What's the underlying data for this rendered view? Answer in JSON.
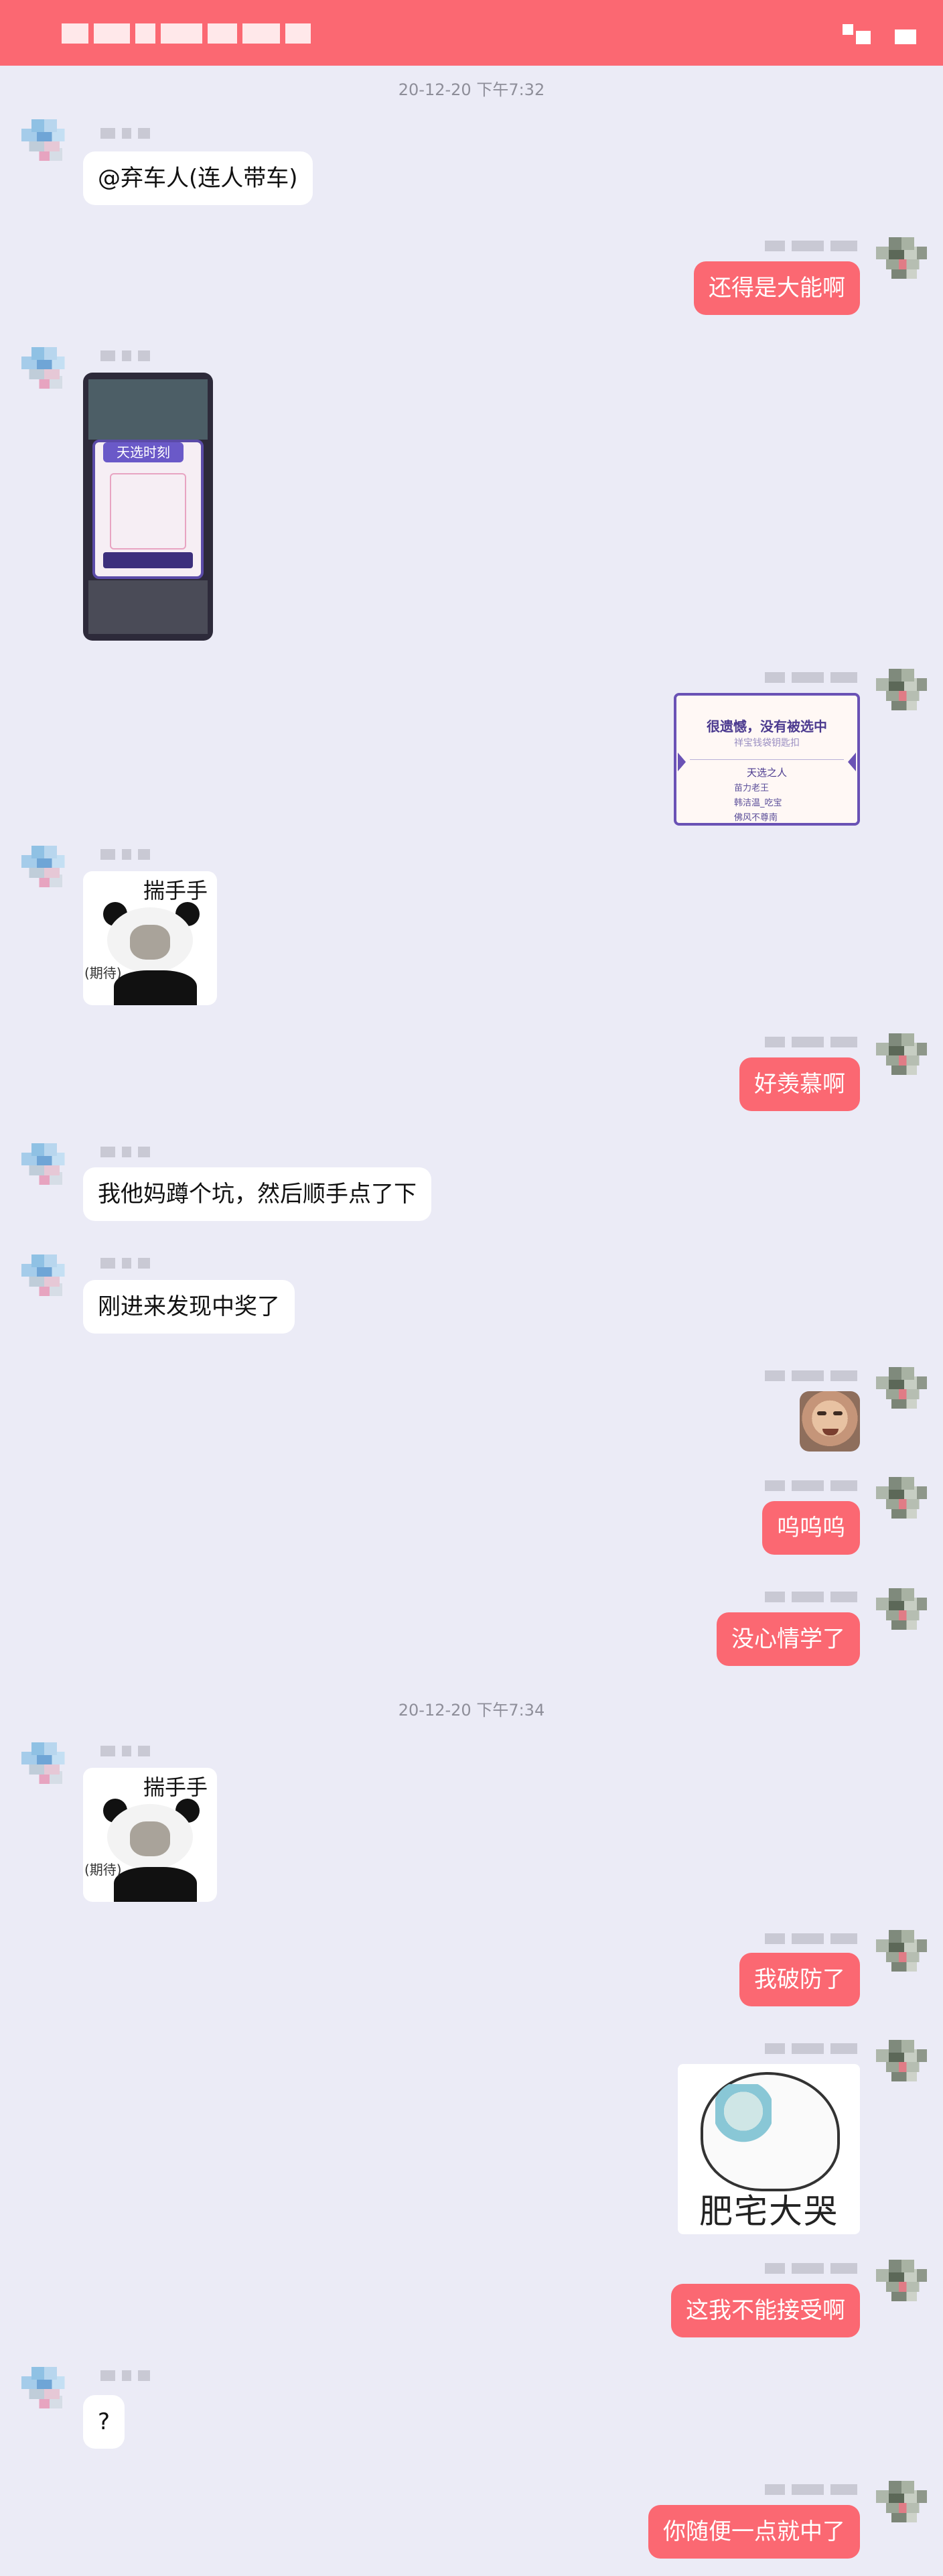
{
  "header": {
    "title": "",
    "icons": [
      "screen-icon",
      "more-icon"
    ]
  },
  "accent_color": "#FB6872",
  "timestamps": [
    "20-12-20 下午7:32",
    "20-12-20 下午7:34"
  ],
  "messages": [
    {
      "side": "left",
      "type": "text",
      "text": "@弃车人(连人带车)"
    },
    {
      "side": "right",
      "type": "text",
      "text": "还得是大能啊"
    },
    {
      "side": "left",
      "type": "image",
      "image": "screenshot-lottery"
    },
    {
      "side": "right",
      "type": "image",
      "image": "result-card"
    },
    {
      "side": "left",
      "type": "sticker",
      "image": "panda-sticker"
    },
    {
      "side": "right",
      "type": "text",
      "text": "好羡慕啊"
    },
    {
      "side": "left",
      "type": "text",
      "text": "我他妈蹲个坑，然后顺手点了下"
    },
    {
      "side": "left",
      "type": "text",
      "text": "刚进来发现中奖了"
    },
    {
      "side": "right",
      "type": "sticker",
      "image": "face-sticker"
    },
    {
      "side": "right",
      "type": "text",
      "text": "呜呜呜"
    },
    {
      "side": "right",
      "type": "text",
      "text": "没心情学了"
    },
    {
      "side": "left",
      "type": "sticker",
      "image": "panda-sticker"
    },
    {
      "side": "right",
      "type": "text",
      "text": "我破防了"
    },
    {
      "side": "right",
      "type": "sticker",
      "image": "crying-sticker"
    },
    {
      "side": "right",
      "type": "text",
      "text": "这我不能接受啊"
    },
    {
      "side": "left",
      "type": "text",
      "text": "?"
    },
    {
      "side": "right",
      "type": "text",
      "text": "你随便一点就中了"
    }
  ],
  "screenshot_lottery": {
    "popup_title": "天选时刻"
  },
  "result_card": {
    "title": "很遗憾，没有被选中",
    "subtitle": "祥宝钱袋钥匙扣",
    "list_head": "天选之人",
    "winners": [
      "苗力老王",
      "韩洁温_吃宝",
      "佛风不尊南"
    ]
  },
  "panda_sticker": {
    "caption": "揣手手",
    "side_text": "(期待)"
  },
  "crying_sticker": {
    "caption": "肥宅大哭"
  }
}
